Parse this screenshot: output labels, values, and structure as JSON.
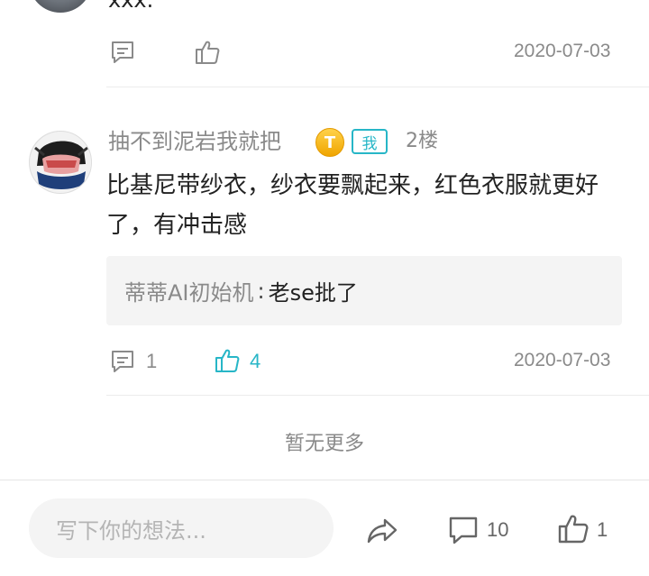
{
  "previous_comment": {
    "text_tail": "xxx.",
    "date": "2020-07-03"
  },
  "comment": {
    "username": "抽不到泥岩我就把",
    "level_badge": "T",
    "me_tag": "我",
    "floor": "2楼",
    "body": "比基尼带纱衣，纱衣要飘起来，红色衣服就更好了，有冲击感",
    "reply": {
      "author": "蒂蒂AI初始机",
      "separator": ":",
      "text": "老se批了"
    },
    "reply_count": "1",
    "like_count": "4",
    "date": "2020-07-03"
  },
  "footer": {
    "no_more": "暂无更多"
  },
  "bottom_bar": {
    "input_placeholder": "写下你的想法...",
    "comment_count": "10",
    "like_count": "1"
  },
  "colors": {
    "accent": "#27b6c7",
    "muted": "#8a8a8a",
    "badge_gold": "#f0a500"
  },
  "icons": {
    "comment": "comment-bubble-icon",
    "like": "thumbs-up-icon",
    "share": "share-arrow-icon"
  }
}
